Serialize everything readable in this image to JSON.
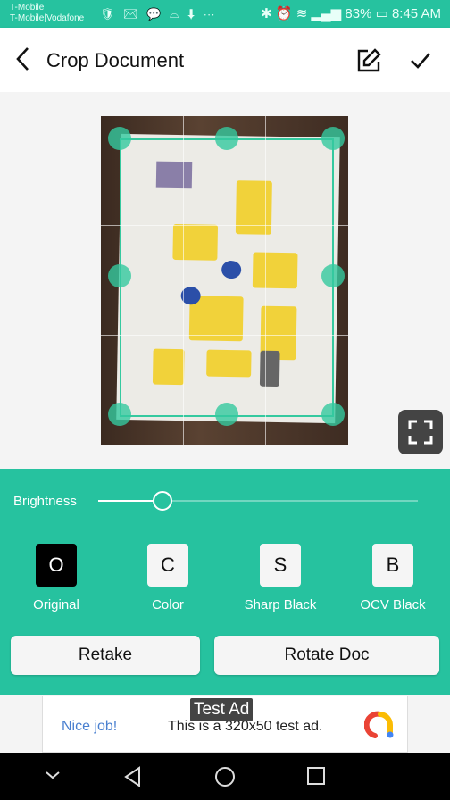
{
  "status_bar": {
    "carrier_1": "T-Mobile",
    "carrier_2": "T-Mobile|Vodafone",
    "notification_icons": [
      "shield-icon",
      "gmail-icon",
      "chat-icon",
      "voicemail-icon",
      "download-icon",
      "more-icon"
    ],
    "battery": "83%",
    "time": "8:45 AM"
  },
  "app_bar": {
    "title": "Crop Document"
  },
  "brightness": {
    "label": "Brightness",
    "value_percent": 20
  },
  "filters": [
    {
      "letter": "O",
      "label": "Original",
      "selected": true
    },
    {
      "letter": "C",
      "label": "Color",
      "selected": false
    },
    {
      "letter": "S",
      "label": "Sharp Black",
      "selected": false
    },
    {
      "letter": "B",
      "label": "OCV Black",
      "selected": false
    }
  ],
  "buttons": {
    "retake": "Retake",
    "rotate": "Rotate Doc"
  },
  "ad": {
    "tag": "Test Ad",
    "headline": "Nice job!",
    "text": "This is a 320x50 test ad."
  },
  "colors": {
    "accent": "#26c29f",
    "crop": "#35c99f"
  }
}
